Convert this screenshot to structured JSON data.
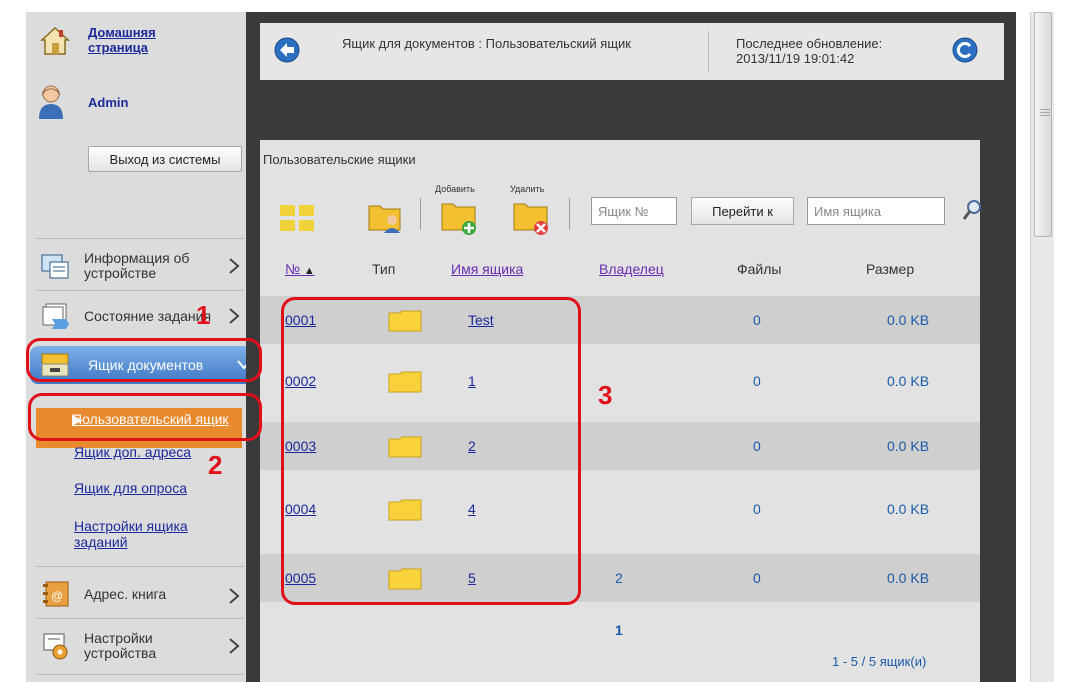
{
  "sidebar": {
    "home_link": "Домашняя страница",
    "user": "Admin",
    "logout_label": "Выход из системы",
    "menu": [
      {
        "label": "Информация об устройстве"
      },
      {
        "label": "Состояние задания"
      },
      {
        "label": "Ящик документов"
      },
      {
        "label": "Адрес. книга"
      },
      {
        "label": "Настройки устройства"
      }
    ],
    "sub_items": [
      {
        "label": "Пользовательский ящик"
      },
      {
        "label": "Ящик доп. адреса"
      },
      {
        "label": "Ящик для опроса"
      },
      {
        "label": "Настройки ящика заданий"
      }
    ]
  },
  "header": {
    "title": "Ящик для документов : Пользовательский ящик",
    "update_label": "Последнее обновление:",
    "update_time": "2013/11/19 19:01:42"
  },
  "panel": {
    "title": "Пользовательские ящики",
    "add_label": "Добавить",
    "delete_label": "Удалить",
    "box_no_placeholder": "Ящик №",
    "go_label": "Перейти к",
    "box_name_placeholder": "Имя ящика",
    "columns": {
      "no": "№",
      "type": "Тип",
      "name": "Имя ящика",
      "owner": "Владелец",
      "files": "Файлы",
      "size": "Размер"
    },
    "rows": [
      {
        "no": "0001",
        "name": "Test",
        "owner": "",
        "files": "0",
        "size": "0.0 KB"
      },
      {
        "no": "0002",
        "name": "1",
        "owner": "",
        "files": "0",
        "size": "0.0 KB"
      },
      {
        "no": "0003",
        "name": "2",
        "owner": "",
        "files": "0",
        "size": "0.0 KB"
      },
      {
        "no": "0004",
        "name": "4",
        "owner": "",
        "files": "0",
        "size": "0.0 KB"
      },
      {
        "no": "0005",
        "name": "5",
        "owner": "2",
        "files": "0",
        "size": "0.0 KB"
      }
    ],
    "page": "1",
    "count": "1 - 5 / 5 ящик(и)"
  },
  "annotations": {
    "one": "1",
    "two": "2",
    "three": "3"
  },
  "colors": {
    "accent_red": "#e0101a",
    "active_blue": "#3d77c6",
    "active_orange": "#e98a2e"
  }
}
